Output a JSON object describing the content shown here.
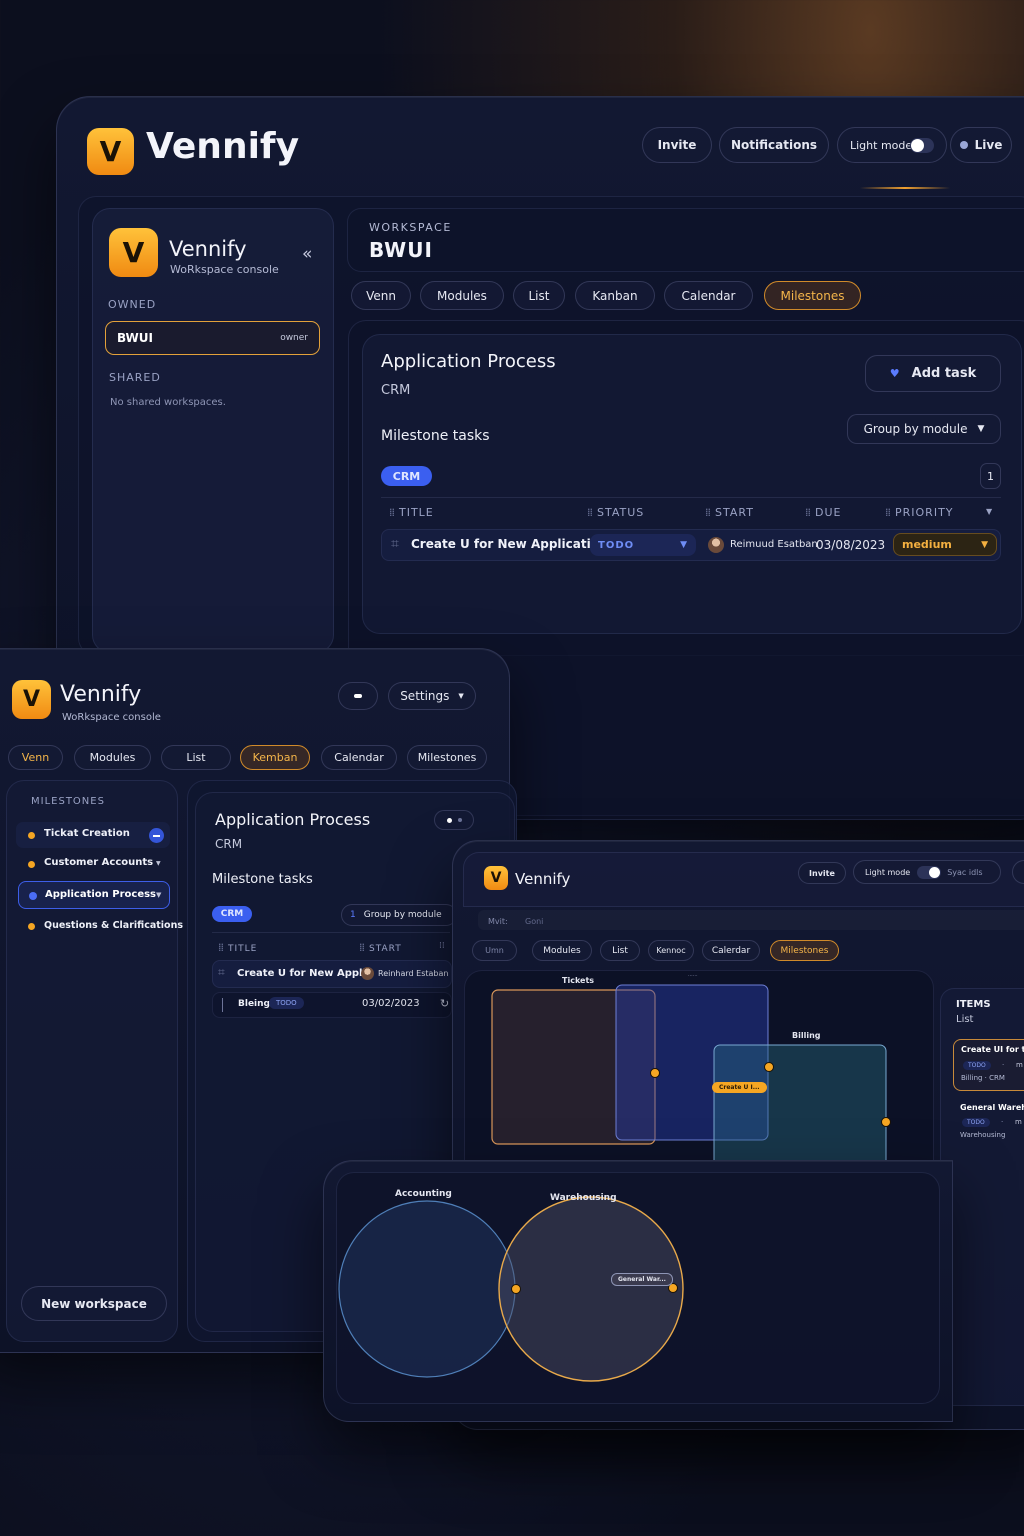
{
  "brand": {
    "name": "Vennify",
    "logo_letter": "V",
    "subtitle": "WoRkspace console",
    "accent": "#f5a623",
    "blue": "#3b5ff0"
  },
  "top": {
    "invite": "Invite",
    "notifications": "Notifications",
    "light_mode": "Light mode",
    "live": "Live"
  },
  "sidebar": {
    "collapse": "«",
    "owned_label": "OWNED",
    "workspace": "BWUI",
    "owner": "owner",
    "shared_label": "SHARED",
    "no_shared": "No shared workspaces."
  },
  "workspace": {
    "label": "WORKSPACE",
    "name": "BWUI"
  },
  "tabs": [
    "Venn",
    "Modules",
    "List",
    "Kanban",
    "Calendar",
    "Milestones"
  ],
  "main": {
    "title": "Application Process",
    "subtitle": "CRM",
    "add_task": "Add task",
    "section": "Milestone tasks",
    "group_by": "Group by module",
    "badge": "CRM",
    "count": "1",
    "columns": [
      "TITLE",
      "STATUS",
      "START",
      "DUE",
      "PRIORITY"
    ],
    "task": {
      "title": "Create U for New Application",
      "status": "TODO",
      "assignee": "Reimuud Esatban",
      "due": "03/08/2023",
      "priority": "medium"
    }
  },
  "w2": {
    "settings": "Settings",
    "tabs": [
      "Venn",
      "Modules",
      "List",
      "Kemban",
      "Calendar",
      "Milestones"
    ],
    "milestones_label": "MILESTONES",
    "milestones": [
      "Tickat Creation",
      "Customer Accounts",
      "Application Process",
      "Questions & Clarifications"
    ],
    "new_workspace": "New workspace",
    "title": "Application Process",
    "subtitle": "CRM",
    "section": "Milestone tasks",
    "badge": "CRM",
    "count": "1",
    "group_by": "Group by module",
    "columns": [
      "TITLE",
      "START"
    ],
    "task": {
      "title": "Create U for New Appli",
      "assignee": "Reinhard Estaban"
    },
    "row2": {
      "name": "Bleing",
      "status": "TODO",
      "date": "03/02/2023"
    }
  },
  "w3": {
    "invite": "Invite",
    "light_mode": "Light mode",
    "sync": "Syac idls",
    "sub_tabs": [
      "Mvit:",
      "Goni"
    ],
    "tabs": [
      "Umn",
      "Modules",
      "List",
      "Kennoc",
      "Calerdar",
      "Milestones"
    ],
    "sets": [
      "Tickets",
      "Billing"
    ],
    "small": "......",
    "tag": "Create U I...",
    "items_title": "ITEMS",
    "items_sub": "List",
    "items": [
      {
        "title": "Create UI for t",
        "status": "TODO",
        "dot": "·",
        "m": "m",
        "meta": "Billing · CRM"
      },
      {
        "title": "General Wareh",
        "status": "TODO",
        "dot": "·",
        "m": "m",
        "meta": "Warehousing"
      }
    ],
    "nav": "›"
  },
  "w4": {
    "sets": [
      "Accounting",
      "Warehousing"
    ],
    "tag": "General War..."
  }
}
